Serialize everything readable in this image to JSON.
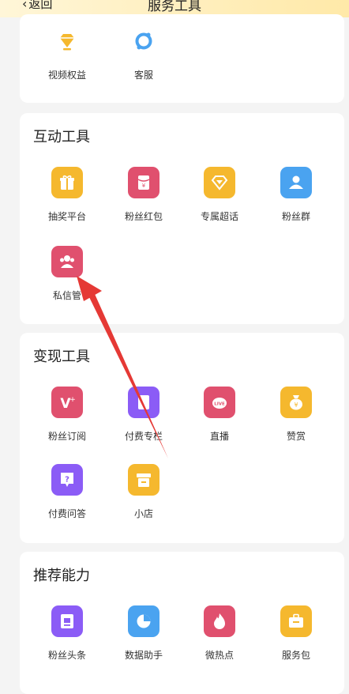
{
  "header": {
    "back_label": "返回",
    "title": "服务工具"
  },
  "sections": [
    {
      "items": [
        {
          "label": "视频权益",
          "icon": "diamond-icon",
          "color": "#ffffff"
        },
        {
          "label": "客服",
          "icon": "headset-icon",
          "color": "#ffffff"
        }
      ]
    },
    {
      "title": "互动工具",
      "items": [
        {
          "label": "抽奖平台",
          "icon": "gift-icon",
          "color": "#f5b82e"
        },
        {
          "label": "粉丝红包",
          "icon": "red-packet-icon",
          "color": "#e0506e"
        },
        {
          "label": "专属超话",
          "icon": "gem-icon",
          "color": "#f5b82e"
        },
        {
          "label": "粉丝群",
          "icon": "group-icon",
          "color": "#4aa3f0"
        },
        {
          "label": "私信管",
          "icon": "private-message-icon",
          "color": "#e0506e"
        }
      ]
    },
    {
      "title": "变现工具",
      "items": [
        {
          "label": "粉丝订阅",
          "icon": "v-plus-icon",
          "color": "#e0506e"
        },
        {
          "label": "付费专栏",
          "icon": "column-icon",
          "color": "#8b5cf6"
        },
        {
          "label": "直播",
          "icon": "live-icon",
          "color": "#e0506e"
        },
        {
          "label": "赞赏",
          "icon": "money-bag-icon",
          "color": "#f5b82e"
        },
        {
          "label": "付费问答",
          "icon": "question-icon",
          "color": "#8b5cf6"
        },
        {
          "label": "小店",
          "icon": "shop-icon",
          "color": "#f5b82e"
        }
      ]
    },
    {
      "title": "推荐能力",
      "items": [
        {
          "label": "粉丝头条",
          "icon": "headline-icon",
          "color": "#8b5cf6"
        },
        {
          "label": "数据助手",
          "icon": "pie-chart-icon",
          "color": "#4aa3f0"
        },
        {
          "label": "微热点",
          "icon": "flame-icon",
          "color": "#e0506e"
        },
        {
          "label": "服务包",
          "icon": "briefcase-icon",
          "color": "#f5b82e"
        }
      ]
    }
  ]
}
